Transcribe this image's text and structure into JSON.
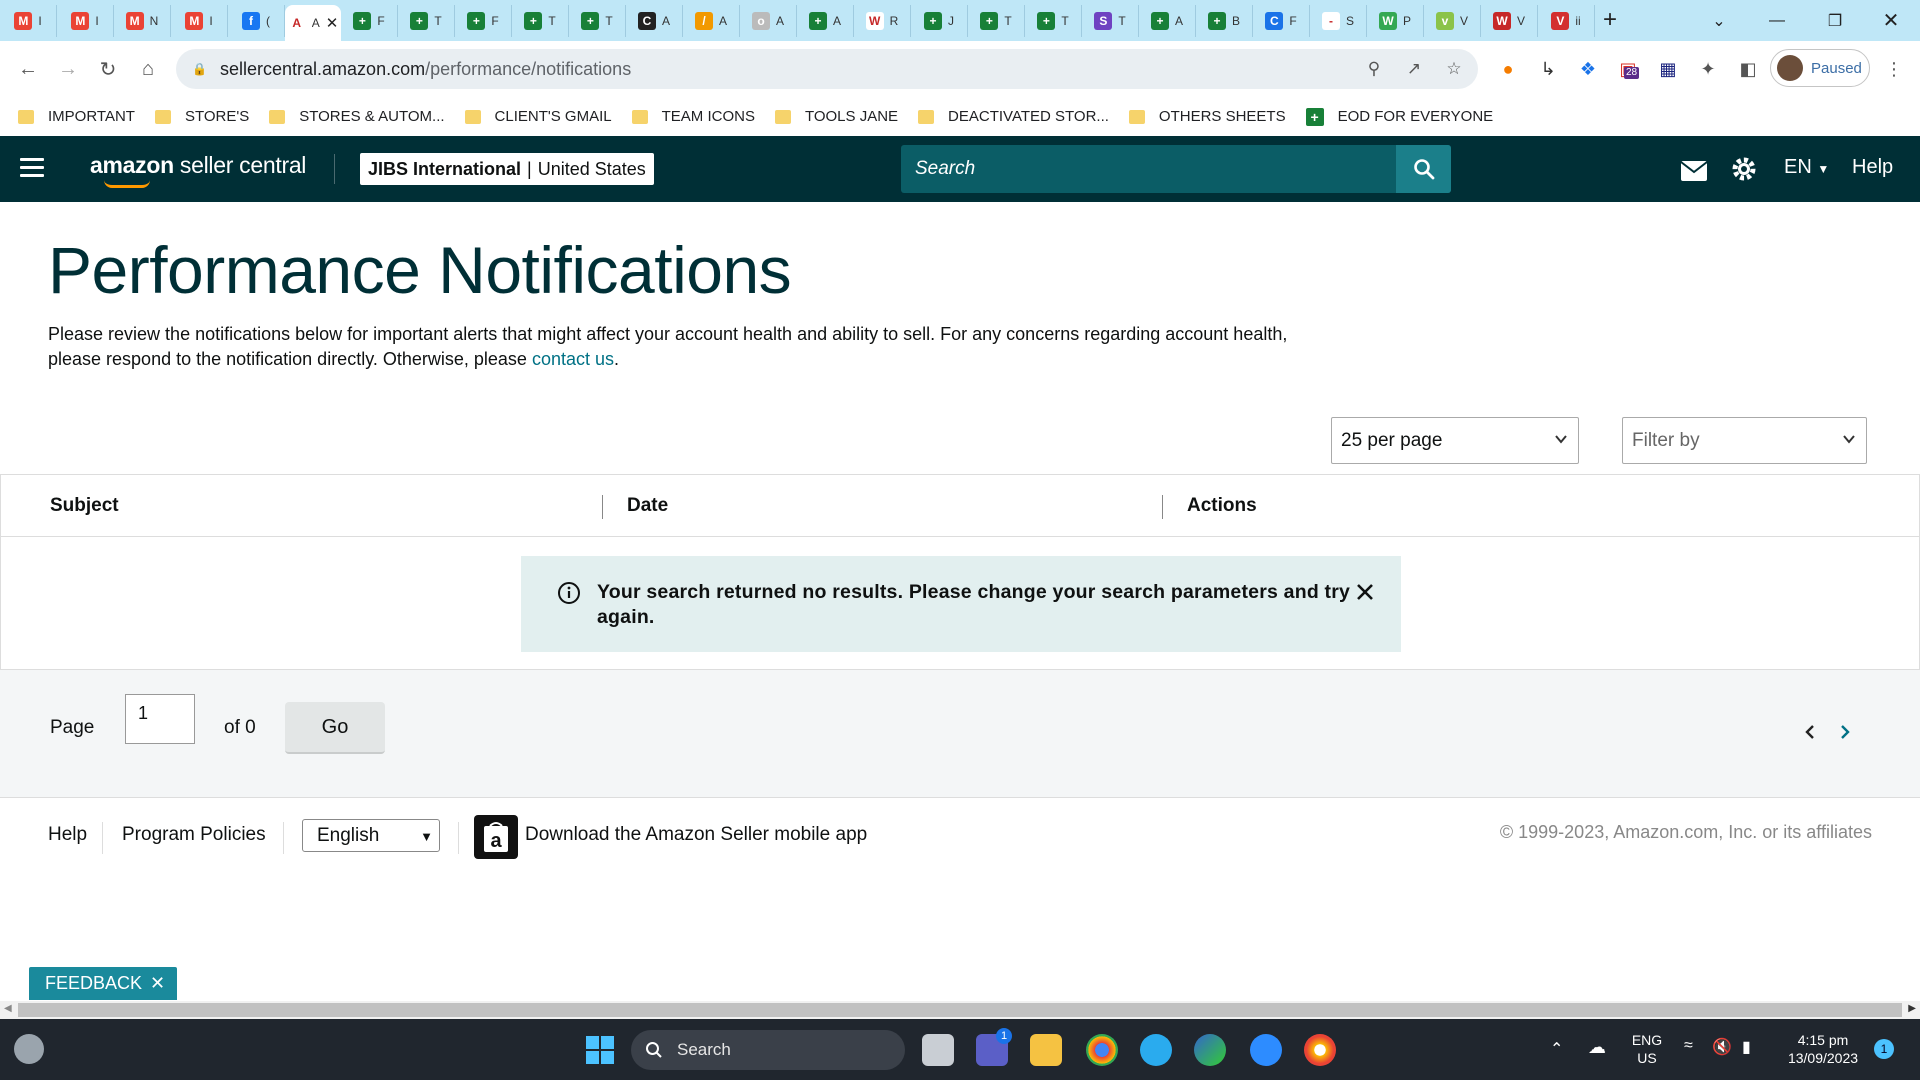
{
  "browser": {
    "tabs": [
      {
        "fav": "M",
        "color": "#ea4335",
        "label": "I"
      },
      {
        "fav": "M",
        "color": "#ea4335",
        "label": "I"
      },
      {
        "fav": "M",
        "color": "#ea4335",
        "label": "N"
      },
      {
        "fav": "M",
        "color": "#ea4335",
        "label": "I"
      },
      {
        "fav": "f",
        "color": "#1877f2",
        "label": "("
      },
      {
        "fav": "A",
        "color": "#ffffff",
        "label": "A",
        "active": true
      },
      {
        "fav": "+",
        "color": "#188038",
        "label": "F"
      },
      {
        "fav": "+",
        "color": "#188038",
        "label": "T"
      },
      {
        "fav": "+",
        "color": "#188038",
        "label": "F"
      },
      {
        "fav": "+",
        "color": "#188038",
        "label": "T"
      },
      {
        "fav": "+",
        "color": "#188038",
        "label": "T"
      },
      {
        "fav": "C",
        "color": "#222222",
        "label": "A"
      },
      {
        "fav": "/",
        "color": "#f29900",
        "label": "A"
      },
      {
        "fav": "o",
        "color": "#bbbbbb",
        "label": "A"
      },
      {
        "fav": "+",
        "color": "#188038",
        "label": "A"
      },
      {
        "fav": "W",
        "color": "#ffffff",
        "label": "R"
      },
      {
        "fav": "+",
        "color": "#188038",
        "label": "J"
      },
      {
        "fav": "+",
        "color": "#188038",
        "label": "T"
      },
      {
        "fav": "+",
        "color": "#188038",
        "label": "T"
      },
      {
        "fav": "S",
        "color": "#6f42c1",
        "label": "T"
      },
      {
        "fav": "+",
        "color": "#188038",
        "label": "A"
      },
      {
        "fav": "+",
        "color": "#188038",
        "label": "B"
      },
      {
        "fav": "C",
        "color": "#1a73e8",
        "label": "F"
      },
      {
        "fav": "-",
        "color": "#ffffff",
        "label": "S"
      },
      {
        "fav": "W",
        "color": "#34a853",
        "label": "P"
      },
      {
        "fav": "v",
        "color": "#8bc34a",
        "label": "V"
      },
      {
        "fav": "W",
        "color": "#c62828",
        "label": "V"
      },
      {
        "fav": "V",
        "color": "#d32f2f",
        "label": "ii"
      }
    ],
    "url_host": "sellercentral.amazon.com",
    "url_path": "/performance/notifications",
    "profile_status": "Paused",
    "extension_badge": "28",
    "bookmarks": [
      {
        "label": "IMPORTANT",
        "icon": "folder"
      },
      {
        "label": "STORE'S",
        "icon": "folder"
      },
      {
        "label": "STORES & AUTOM...",
        "icon": "folder"
      },
      {
        "label": "CLIENT'S GMAIL",
        "icon": "folder"
      },
      {
        "label": "TEAM ICONS",
        "icon": "folder"
      },
      {
        "label": "TOOLS JANE",
        "icon": "folder"
      },
      {
        "label": "DEACTIVATED STOR...",
        "icon": "folder"
      },
      {
        "label": "OTHERS SHEETS",
        "icon": "folder"
      },
      {
        "label": "EOD FOR EVERYONE",
        "icon": "sheet"
      }
    ]
  },
  "header": {
    "logo_bold": "amazon",
    "logo_rest": " seller central",
    "account_name": "JIBS International",
    "account_region": "United States",
    "search_placeholder": "Search",
    "language": "EN",
    "help": "Help",
    "colors": {
      "bar": "#002f36",
      "search": "#0b5d66",
      "accent": "#ff9900"
    }
  },
  "main": {
    "title": "Performance Notifications",
    "description": "Please review the notifications below for important alerts that might affect your account health and ability to sell. For any concerns regarding account health, please respond to the notification directly. Otherwise, please",
    "contact_link": "contact us",
    "description_end": ".",
    "per_page": "25 per page",
    "filter_placeholder": "Filter by",
    "columns": [
      "Subject",
      "Date",
      "Actions"
    ],
    "alert_message": "Your search returned no results. Please change your search parameters and try again.",
    "pager": {
      "page_label": "Page",
      "page_value": "1",
      "of_label": "of 0",
      "go_label": "Go"
    }
  },
  "footer": {
    "help": "Help",
    "policies": "Program Policies",
    "language": "English",
    "download": "Download the Amazon Seller mobile app",
    "copyright": "© 1999-2023, Amazon.com, Inc. or its affiliates",
    "feedback": "FEEDBACK"
  },
  "taskbar": {
    "search": "Search",
    "lang_line1": "ENG",
    "lang_line2": "US",
    "time": "4:15 pm",
    "date": "13/09/2023",
    "notification_count": "1",
    "teams_badge": "1"
  }
}
